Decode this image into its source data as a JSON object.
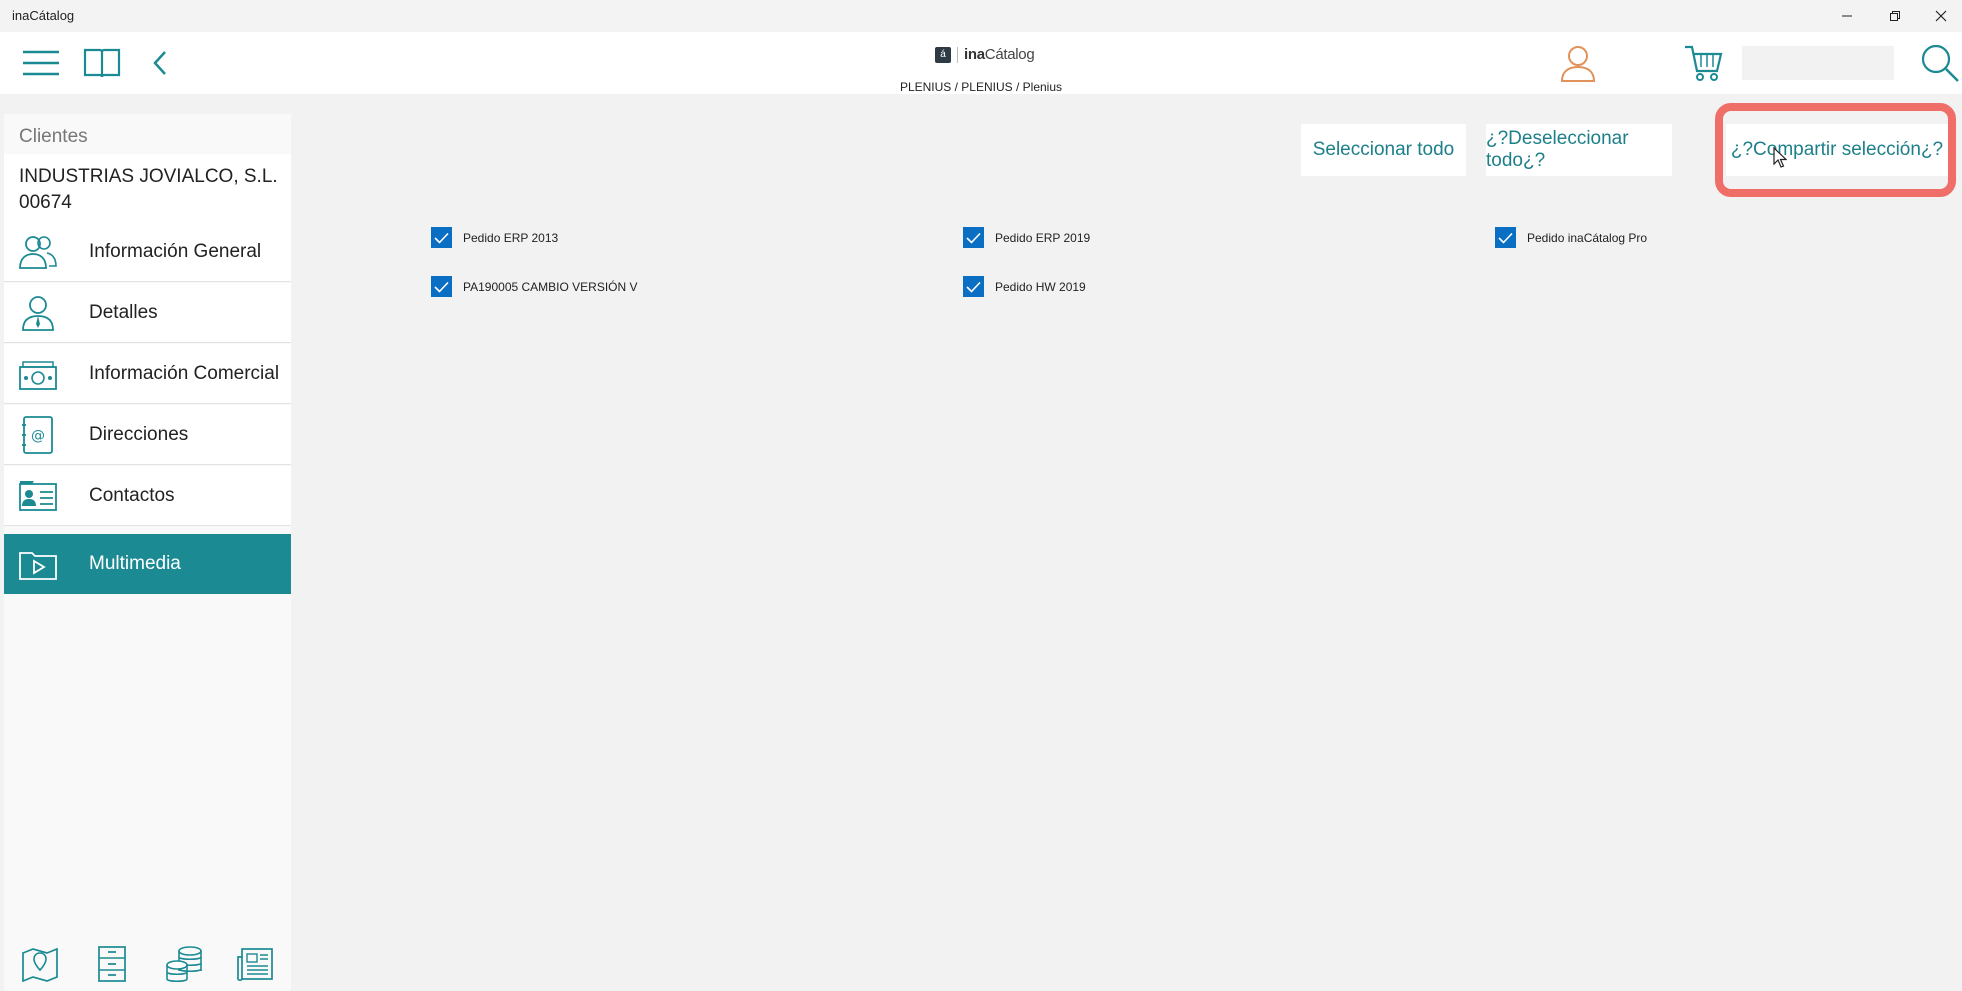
{
  "window": {
    "title": "inaCátalog",
    "controls": [
      "minimize-icon",
      "restore-icon",
      "close-icon"
    ]
  },
  "header": {
    "logo_text_bold": "ina",
    "logo_text": "Cátalog",
    "breadcrumb": "PLENIUS / PLENIUS / Plenius",
    "search": {
      "value": "",
      "placeholder": ""
    },
    "icons": [
      "hamburger-menu-icon",
      "book-icon",
      "back-arrow-icon",
      "user-icon",
      "cart-icon",
      "search-icon"
    ]
  },
  "sidebar": {
    "heading": "Clientes",
    "client": {
      "name": "INDUSTRIAS JOVIALCO, S.L.",
      "code": "00674"
    },
    "items": [
      {
        "label": "Información General",
        "icon": "users-icon"
      },
      {
        "label": "Detalles",
        "icon": "person-icon"
      },
      {
        "label": "Información Comercial",
        "icon": "money-icon"
      },
      {
        "label": "Direcciones",
        "icon": "address-book-icon"
      },
      {
        "label": "Contactos",
        "icon": "contact-card-icon"
      },
      {
        "label": "Multimedia",
        "icon": "media-folder-icon",
        "active": true
      }
    ],
    "bottom_icons": [
      "map-icon",
      "cabinet-icon",
      "coins-icon",
      "newspaper-icon"
    ]
  },
  "main": {
    "buttons": {
      "select_all": "Seleccionar todo",
      "deselect_all": "¿?Deseleccionar todo¿?",
      "share_selection": "¿?Compartir selección¿?"
    },
    "items": [
      {
        "label": "Pedido ERP 2013",
        "checked": true
      },
      {
        "label": "Pedido ERP 2019",
        "checked": true
      },
      {
        "label": "Pedido inaCátalog Pro",
        "checked": true
      },
      {
        "label": "PA190005 CAMBIO VERSIÓN V",
        "checked": true
      },
      {
        "label": "Pedido HW 2019",
        "checked": true
      }
    ]
  },
  "colors": {
    "accent": "#1c8a93",
    "button_text": "#1c7f8a",
    "checkbox": "#0a6fc2",
    "highlight": "#ef6f68",
    "user_icon": "#e0925a"
  }
}
